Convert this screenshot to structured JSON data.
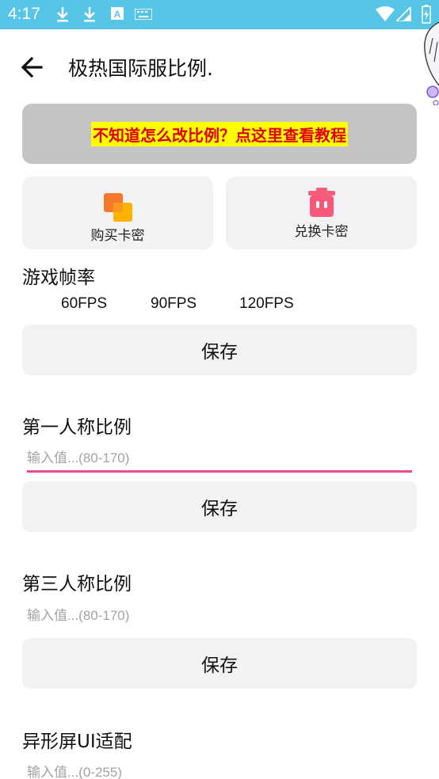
{
  "status_bar": {
    "time": "4:17",
    "color": "#56c5e6"
  },
  "app_bar": {
    "title": "极热国际服比例."
  },
  "banner": {
    "text": "不知道怎么改比例？点这里查看教程",
    "text_color": "#e00000",
    "highlight_color": "#ffff00"
  },
  "cards": [
    {
      "label": "购买卡密",
      "icon": "orange-squares-icon"
    },
    {
      "label": "兑换卡密",
      "icon": "pink-bin-icon"
    }
  ],
  "fps_section": {
    "title": "游戏帧率",
    "options": [
      "60FPS",
      "90FPS",
      "120FPS"
    ],
    "save_label": "保存"
  },
  "first_person": {
    "title": "第一人称比例",
    "placeholder": "输入值...(80-170)",
    "save_label": "保存"
  },
  "third_person": {
    "title": "第三人称比例",
    "placeholder": "输入值...(80-170)",
    "save_label": "保存"
  },
  "notch_ui": {
    "title": "异形屏UI适配",
    "placeholder": "输入值...(0-255)"
  },
  "colors": {
    "accent_underline": "#e84a8a",
    "button_bg": "#f2f2f2"
  }
}
